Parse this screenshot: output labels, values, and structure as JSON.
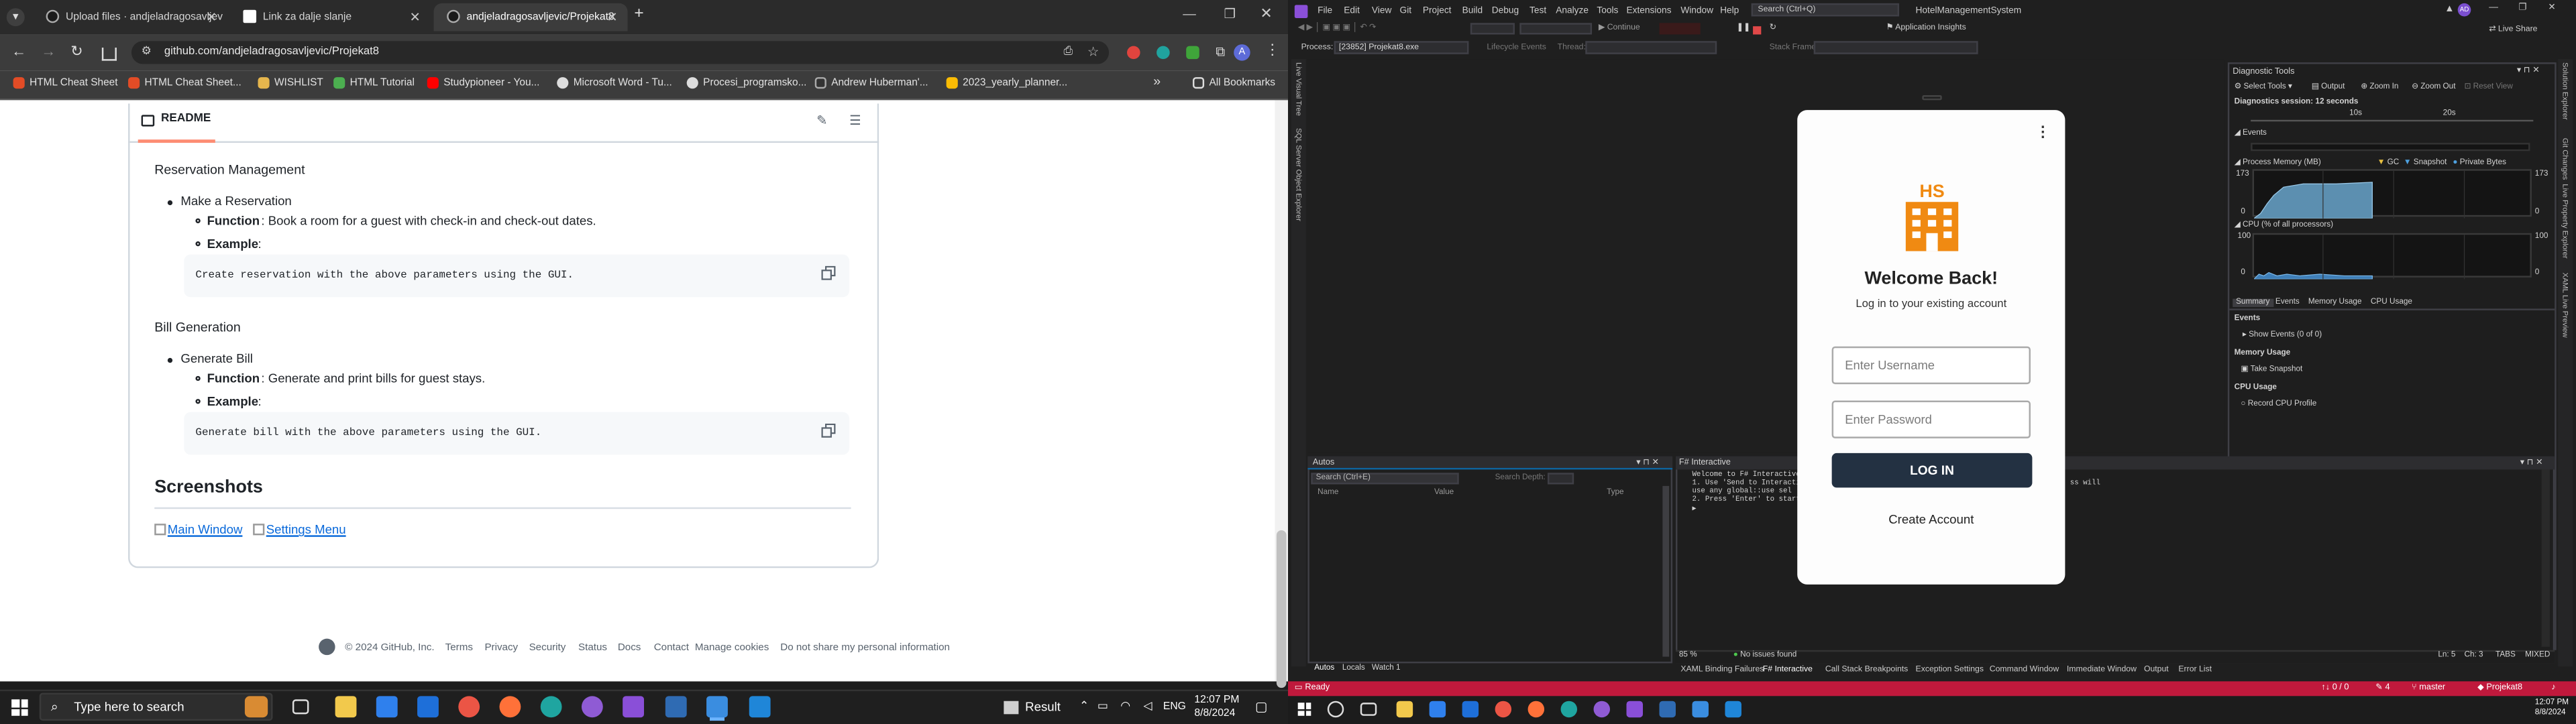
{
  "browser": {
    "tabs": [
      {
        "title": "Upload files · andjeladragosavljev",
        "active": false,
        "favicon": "github-icon"
      },
      {
        "title": "Link za dalje slanje",
        "active": false,
        "favicon": "doc-icon"
      },
      {
        "title": "andjeladragosavljevic/Projekat8",
        "active": true,
        "favicon": "github-icon"
      }
    ],
    "url": "github.com/andjeladragosavljevic/Projekat8",
    "bookmarks": [
      "HTML Cheat Sheet",
      "HTML Cheat Sheet...",
      "WISHLIST",
      "HTML Tutorial",
      "Studypioneer - You...",
      "Microsoft Word - Tu...",
      "Procesi_programsko...",
      "Andrew Huberman'...",
      "2023_yearly_planner..."
    ],
    "all_bookmarks": "All Bookmarks"
  },
  "readme": {
    "header": "README",
    "section1_title": "Reservation Management",
    "make_reservation": "Make a Reservation",
    "function_label": "Function",
    "function1": ": Book a room for a guest with check-in and check-out dates.",
    "example_label": "Example",
    "example_colon": ":",
    "code1": "Create reservation with the above parameters using the GUI.",
    "section2_title": "Bill Generation",
    "generate_bill": "Generate Bill",
    "function2": ": Generate and print bills for guest stays.",
    "code2": "Generate bill with the above parameters using the GUI.",
    "screenshots_title": "Screenshots",
    "link1": "Main Window",
    "link2": "Settings Menu"
  },
  "footer": {
    "copyright": "© 2024 GitHub, Inc.",
    "links": [
      "Terms",
      "Privacy",
      "Security",
      "Status",
      "Docs",
      "Contact",
      "Manage cookies",
      "Do not share my personal information"
    ]
  },
  "taskbar": {
    "search_placeholder": "Type here to search",
    "result": "Result",
    "lang": "ENG",
    "time": "12:07 PM",
    "date": "8/8/2024"
  },
  "vs": {
    "menu": [
      "File",
      "Edit",
      "View",
      "Git",
      "Project",
      "Build",
      "Debug",
      "Test",
      "Analyze",
      "Tools",
      "Extensions",
      "Window",
      "Help"
    ],
    "search": "Search (Ctrl+Q)",
    "solution": "HotelManagementSystem",
    "live_share": "Live Share",
    "process_label": "Process:",
    "process_value": "[23852] Projekat8.exe",
    "lifecycle": "Lifecycle Events",
    "thread": "Thread:",
    "stack_frame": "Stack Frame:",
    "continue": "Continue",
    "app_insights": "Application Insights",
    "diag": {
      "title": "Diagnostic Tools",
      "select_tools": "Select Tools",
      "output": "Output",
      "zoom_in": "Zoom In",
      "zoom_out": "Zoom Out",
      "reset_view": "Reset View",
      "session": "Diagnostics session: 12 seconds",
      "t10": "10s",
      "t20": "20s",
      "events": "Events",
      "process_memory": "Process Memory (MB)",
      "gc": "GC",
      "snapshot": "Snapshot",
      "private_bytes": "Private Bytes",
      "mem_max": "173",
      "mem_min": "0",
      "cpu": "CPU (% of all processors)",
      "cpu_max": "100",
      "cpu_min": "0",
      "tabs": [
        "Summary",
        "Events",
        "Memory Usage",
        "CPU Usage"
      ],
      "events_h": "Events",
      "show_events": "Show Events (0 of 0)",
      "memory_usage": "Memory Usage",
      "take_snapshot": "Take Snapshot",
      "cpu_usage": "CPU Usage",
      "record_cpu": "Record CPU Profile"
    },
    "autos": {
      "title": "Autos",
      "search": "Search (Ctrl+E)",
      "search_depth": "Search Depth:",
      "cols": [
        "Name",
        "Value",
        "Type"
      ],
      "bottom_tabs": [
        "Autos",
        "Locals",
        "Watch 1"
      ]
    },
    "fsi": {
      "title": "F# Interactive",
      "lines": [
        "Welcome to F# Interactive fo",
        "1. Use 'Send to Interacti",
        "   use any global::use sel",
        "2. Press 'Enter' to start"
      ],
      "tail": "ss will",
      "zoom": "85 %",
      "no_issues": "No issues found",
      "ln": "Ln: 5",
      "ch": "Ch: 3",
      "tabs_ind": "TABS",
      "mixed": "MIXED"
    },
    "bottom_tabs": [
      "XAML Binding Failures",
      "F# Interactive",
      "Call Stack",
      "Breakpoints",
      "Exception Settings",
      "Command Window",
      "Immediate Window",
      "Output",
      "Error List"
    ],
    "side_tabs_left": [
      "Live Visual Tree",
      "SQL Server Object Explorer"
    ],
    "side_tabs_right": [
      "Solution Explorer",
      "Git Changes",
      "Live Property Explorer",
      "XAML Live Preview"
    ],
    "status": {
      "ready": "Ready",
      "errors": "0 / 0",
      "pencil": "4",
      "branch": "master",
      "project": "Projekat8"
    }
  },
  "login": {
    "title": "Welcome Back!",
    "subtitle": "Log in to your existing account",
    "username_placeholder": "Enter Username",
    "password_placeholder": "Enter Password",
    "login_button": "LOG IN",
    "create_account": "Create Account",
    "menu_glyph": "⋮",
    "brand_color": "#f08a12"
  }
}
